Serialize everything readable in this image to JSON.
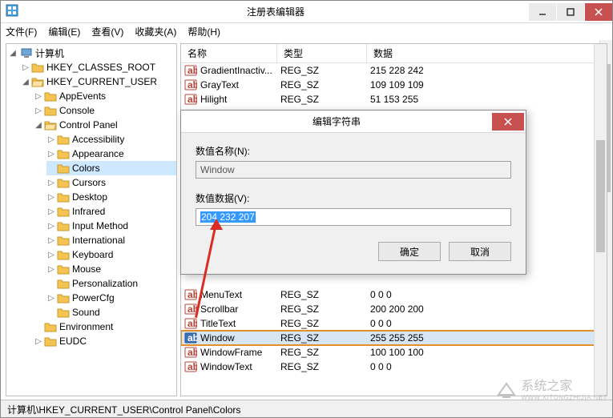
{
  "window": {
    "title": "注册表编辑器",
    "statusbar": "计算机\\HKEY_CURRENT_USER\\Control Panel\\Colors"
  },
  "menubar": {
    "file": "文件(F)",
    "edit": "编辑(E)",
    "view": "查看(V)",
    "favorites": "收藏夹(A)",
    "help": "帮助(H)"
  },
  "tree": {
    "root": "计算机",
    "hkcr": "HKEY_CLASSES_ROOT",
    "hkcu": "HKEY_CURRENT_USER",
    "appevents": "AppEvents",
    "console": "Console",
    "controlpanel": "Control Panel",
    "accessibility": "Accessibility",
    "appearance": "Appearance",
    "colors": "Colors",
    "cursors": "Cursors",
    "desktop": "Desktop",
    "infrared": "Infrared",
    "inputmethod": "Input Method",
    "international": "International",
    "keyboard": "Keyboard",
    "mouse": "Mouse",
    "personalization": "Personalization",
    "powercfg": "PowerCfg",
    "sound": "Sound",
    "environment": "Environment",
    "eudc": "EUDC"
  },
  "list": {
    "headers": {
      "name": "名称",
      "type": "类型",
      "data": "数据"
    },
    "rows": [
      {
        "name": "GradientInactiv...",
        "type": "REG_SZ",
        "data": "215 228 242"
      },
      {
        "name": "GrayText",
        "type": "REG_SZ",
        "data": "109 109 109"
      },
      {
        "name": "Hilight",
        "type": "REG_SZ",
        "data": "51 153 255"
      },
      {
        "name": "MenuText",
        "type": "REG_SZ",
        "data": "0 0 0"
      },
      {
        "name": "Scrollbar",
        "type": "REG_SZ",
        "data": "200 200 200"
      },
      {
        "name": "TitleText",
        "type": "REG_SZ",
        "data": "0 0 0"
      },
      {
        "name": "Window",
        "type": "REG_SZ",
        "data": "255 255 255",
        "selected": true
      },
      {
        "name": "WindowFrame",
        "type": "REG_SZ",
        "data": "100 100 100"
      },
      {
        "name": "WindowText",
        "type": "REG_SZ",
        "data": "0 0 0"
      }
    ]
  },
  "dialog": {
    "title": "编辑字符串",
    "name_label": "数值名称(N):",
    "name_value": "Window",
    "data_label": "数值数据(V):",
    "data_value": "204 232 207",
    "ok": "确定",
    "cancel": "取消"
  },
  "watermark": {
    "brand": "系统之家",
    "url": "WWW.XITONGZHIJIA.NET"
  }
}
